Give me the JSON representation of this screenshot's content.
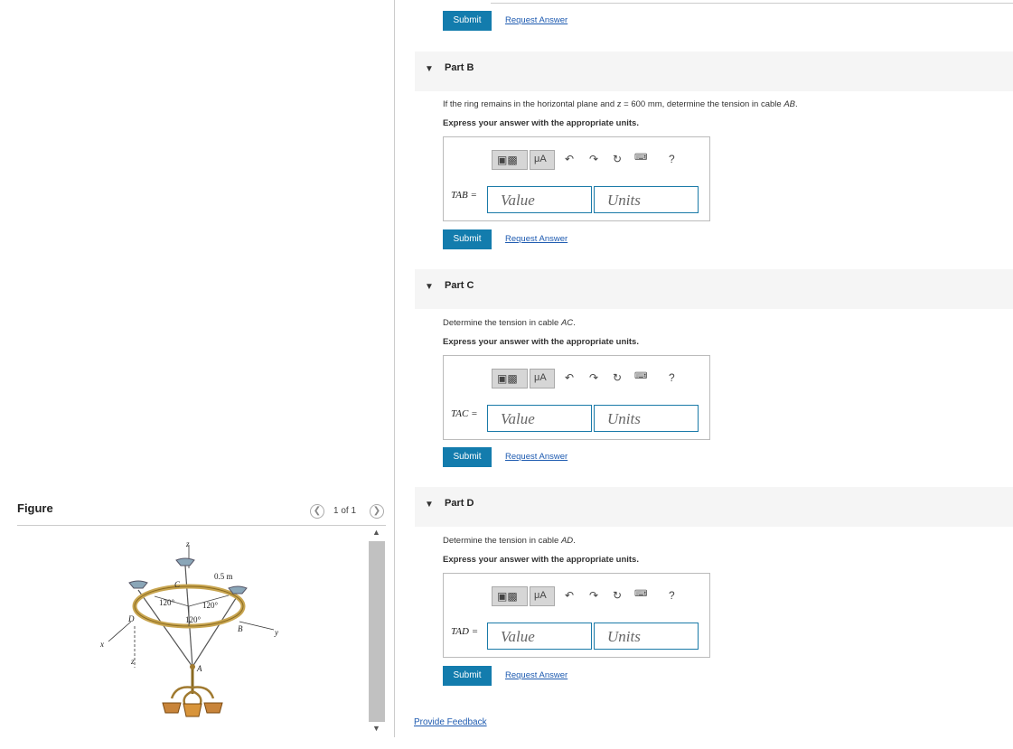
{
  "figure": {
    "title": "Figure",
    "pager": "1 of 1",
    "labels": {
      "z_top": "z",
      "c": "C",
      "radius": "0.5 m",
      "angle_left": "120°",
      "angle_right": "120°",
      "angle_bottom": "120°",
      "d": "D",
      "b": "B",
      "y": "y",
      "x": "x",
      "z_side": "z",
      "a": "A"
    }
  },
  "ui": {
    "submit_label": "Submit",
    "request_answer_label": "Request Answer",
    "value_placeholder": "Value",
    "units_placeholder": "Units",
    "toolbar_ua": "μA",
    "toolbar_help": "?",
    "provide_feedback": "Provide Feedback"
  },
  "parts": {
    "b": {
      "label": "Part B",
      "question_pre": "If the ring remains in the horizontal plane and z = 600 mm, determine the tension in cable ",
      "question_cable": "AB",
      "question_post": ".",
      "instruction": "Express your answer with the appropriate units.",
      "var_label": "TAB ="
    },
    "c": {
      "label": "Part C",
      "question_pre": "Determine the tension in cable ",
      "question_cable": "AC",
      "question_post": ".",
      "instruction": "Express your answer with the appropriate units.",
      "var_label": "TAC ="
    },
    "d": {
      "label": "Part D",
      "question_pre": "Determine the tension in cable ",
      "question_cable": "AD",
      "question_post": ".",
      "instruction": "Express your answer with the appropriate units.",
      "var_label": "TAD ="
    }
  },
  "colors": {
    "submit": "#137cad",
    "link": "#1d5ab0",
    "field_border": "#1a7aa8",
    "header_bg": "#f5f5f5"
  }
}
